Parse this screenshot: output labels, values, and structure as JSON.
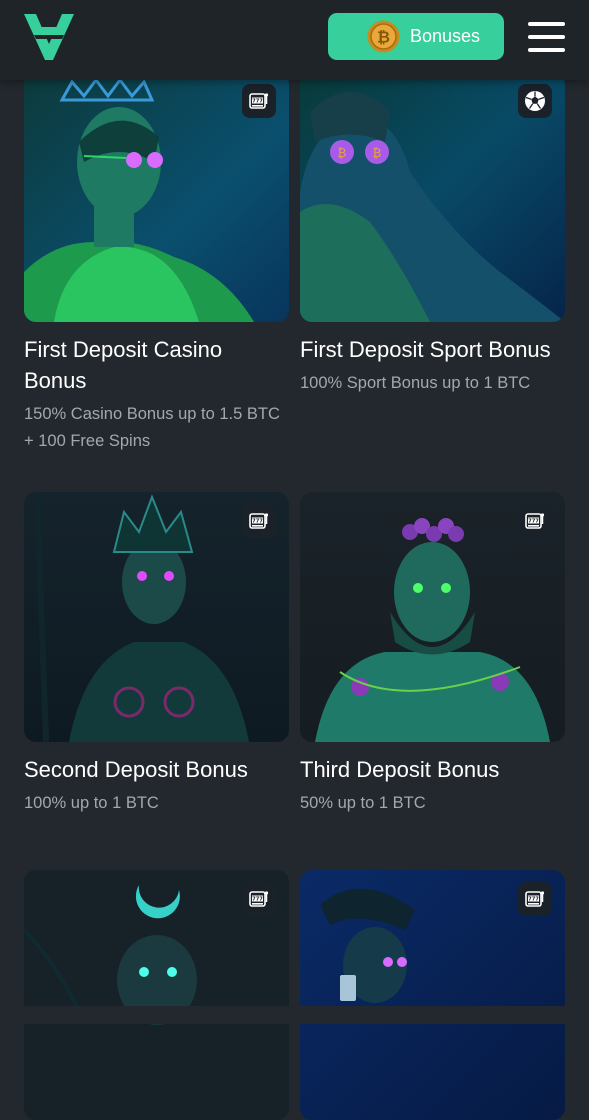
{
  "header": {
    "logo_icon": "v-logo-icon",
    "bonuses_label": "Bonuses",
    "coin_icon": "bitcoin-coin-icon",
    "menu_icon": "hamburger-menu-icon",
    "accent_color": "#37cf9c"
  },
  "cards": [
    {
      "title": "First Deposit Casino Bonus",
      "description": "150% Casino Bonus up to 1.5 BTC + 100 Free Spins",
      "badge_icon": "slot-machine-icon"
    },
    {
      "title": "First Deposit Sport Bonus",
      "description": "100% Sport Bonus up to 1 BTC",
      "badge_icon": "soccer-ball-icon"
    },
    {
      "title": "Second Deposit Bonus",
      "description": "100% up to 1 BTC",
      "badge_icon": "slot-machine-icon"
    },
    {
      "title": "Third Deposit Bonus",
      "description": "50% up to 1 BTC",
      "badge_icon": "slot-machine-icon"
    },
    {
      "title": "",
      "description": "",
      "badge_icon": "slot-machine-icon"
    },
    {
      "title": "",
      "description": "",
      "badge_icon": "slot-machine-icon"
    }
  ]
}
